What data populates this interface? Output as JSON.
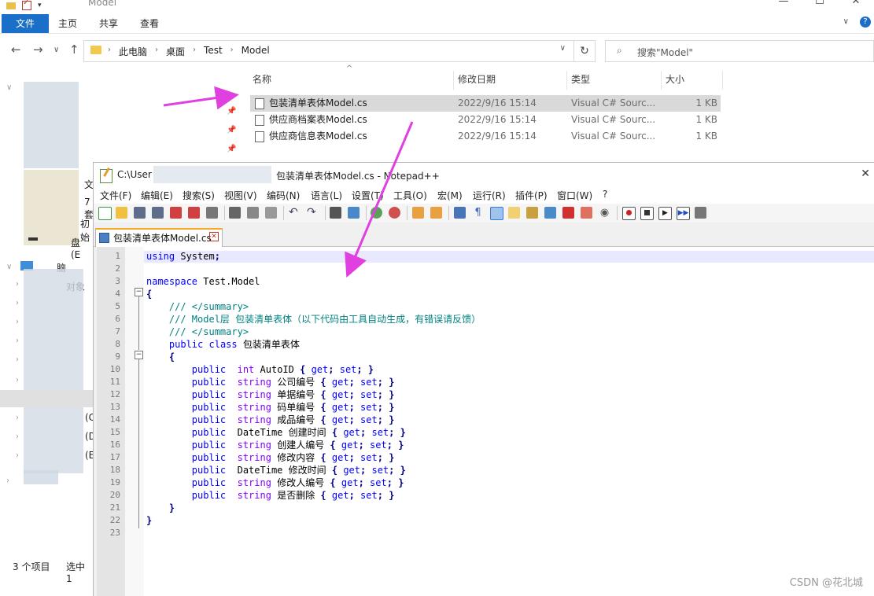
{
  "explorer": {
    "title": "Model",
    "ribbon_tabs": [
      "文件",
      "主页",
      "共享",
      "查看"
    ],
    "breadcrumbs": [
      "此电脑",
      "桌面",
      "Test",
      "Model"
    ],
    "search_placeholder": "搜索\"Model\"",
    "columns": {
      "name": "名称",
      "date": "修改日期",
      "type": "类型",
      "size": "大小"
    },
    "files": [
      {
        "name": "包装清单表体Model.cs",
        "date": "2022/9/16 15:14",
        "type": "Visual C# Sourc...",
        "size": "1 KB",
        "selected": true
      },
      {
        "name": "供应商档案表Model.cs",
        "date": "2022/9/16 15:14",
        "type": "Visual C# Sourc...",
        "size": "1 KB",
        "selected": false
      },
      {
        "name": "供应商信息表Model.cs",
        "date": "2022/9/16 15:14",
        "type": "Visual C# Sourc...",
        "size": "1 KB",
        "selected": false
      }
    ],
    "nav_fragments": [
      "文",
      "7套",
      "初始",
      "盘 (E",
      "脑",
      "对象",
      "(C",
      "(D",
      "(E"
    ],
    "status_count": "3 个项目",
    "status_selected": "选中 1"
  },
  "npp": {
    "title_prefix": "C:\\User",
    "title_suffix": "包装清单表体Model.cs - Notepad++",
    "menu": [
      "文件(F)",
      "编辑(E)",
      "搜索(S)",
      "视图(V)",
      "编码(N)",
      "语言(L)",
      "设置(T)",
      "工具(O)",
      "宏(M)",
      "运行(R)",
      "插件(P)",
      "窗口(W)",
      "?"
    ],
    "tab_label": "包装清单表体Model.cs",
    "code_lines": [
      "using System;",
      "",
      "namespace Test.Model",
      "{",
      "    /// </summary>",
      "    /// Model层 包装清单表体（以下代码由工具自动生成，有错误请反馈）",
      "    /// </summary>",
      "    public class 包装清单表体",
      "    {",
      "        public  int AutoID { get; set; }",
      "        public  string 公司编号 { get; set; }",
      "        public  string 单据编号 { get; set; }",
      "        public  string 码单编号 { get; set; }",
      "        public  string 成品编号 { get; set; }",
      "        public  DateTime 创建时间 { get; set; }",
      "        public  string 创建人编号 { get; set; }",
      "        public  string 修改内容 { get; set; }",
      "        public  DateTime 修改时间 { get; set; }",
      "        public  string 修改人编号 { get; set; }",
      "        public  string 是否删除 { get; set; }",
      "    }",
      "}",
      ""
    ]
  },
  "watermark": "CSDN @花北城",
  "colors": {
    "arrow": "#e040e0",
    "accent": "#1a6fc9",
    "selection": "#d9d9d9"
  }
}
